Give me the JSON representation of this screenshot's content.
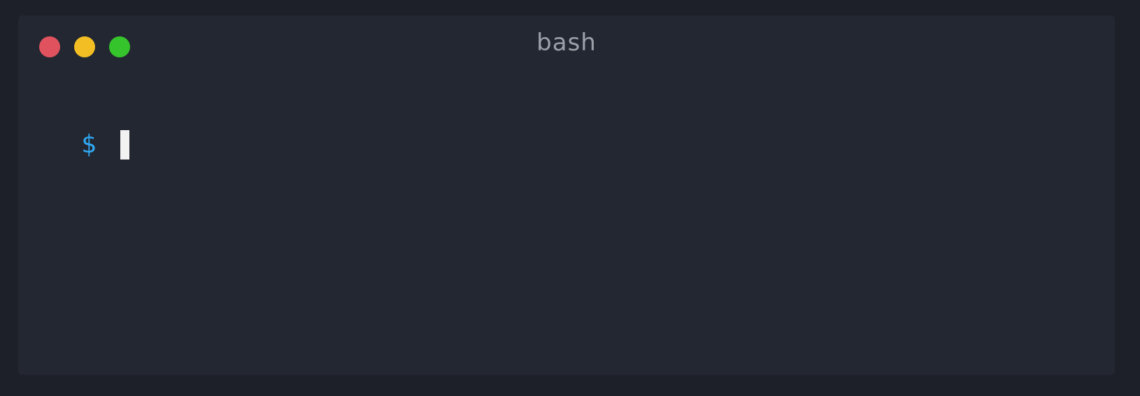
{
  "window": {
    "title": "bash",
    "controls": {
      "close": "close",
      "minimize": "minimize",
      "maximize": "maximize"
    }
  },
  "terminal": {
    "prompt": "$",
    "input_value": ""
  },
  "colors": {
    "page_background": "#1e2029",
    "window_background": "#232731",
    "title_text": "#9ca0a8",
    "prompt": "#2fa9f4",
    "cursor": "#f2f2f2",
    "close": "#e0535e",
    "minimize": "#f3be24",
    "maximize": "#36c42c"
  }
}
